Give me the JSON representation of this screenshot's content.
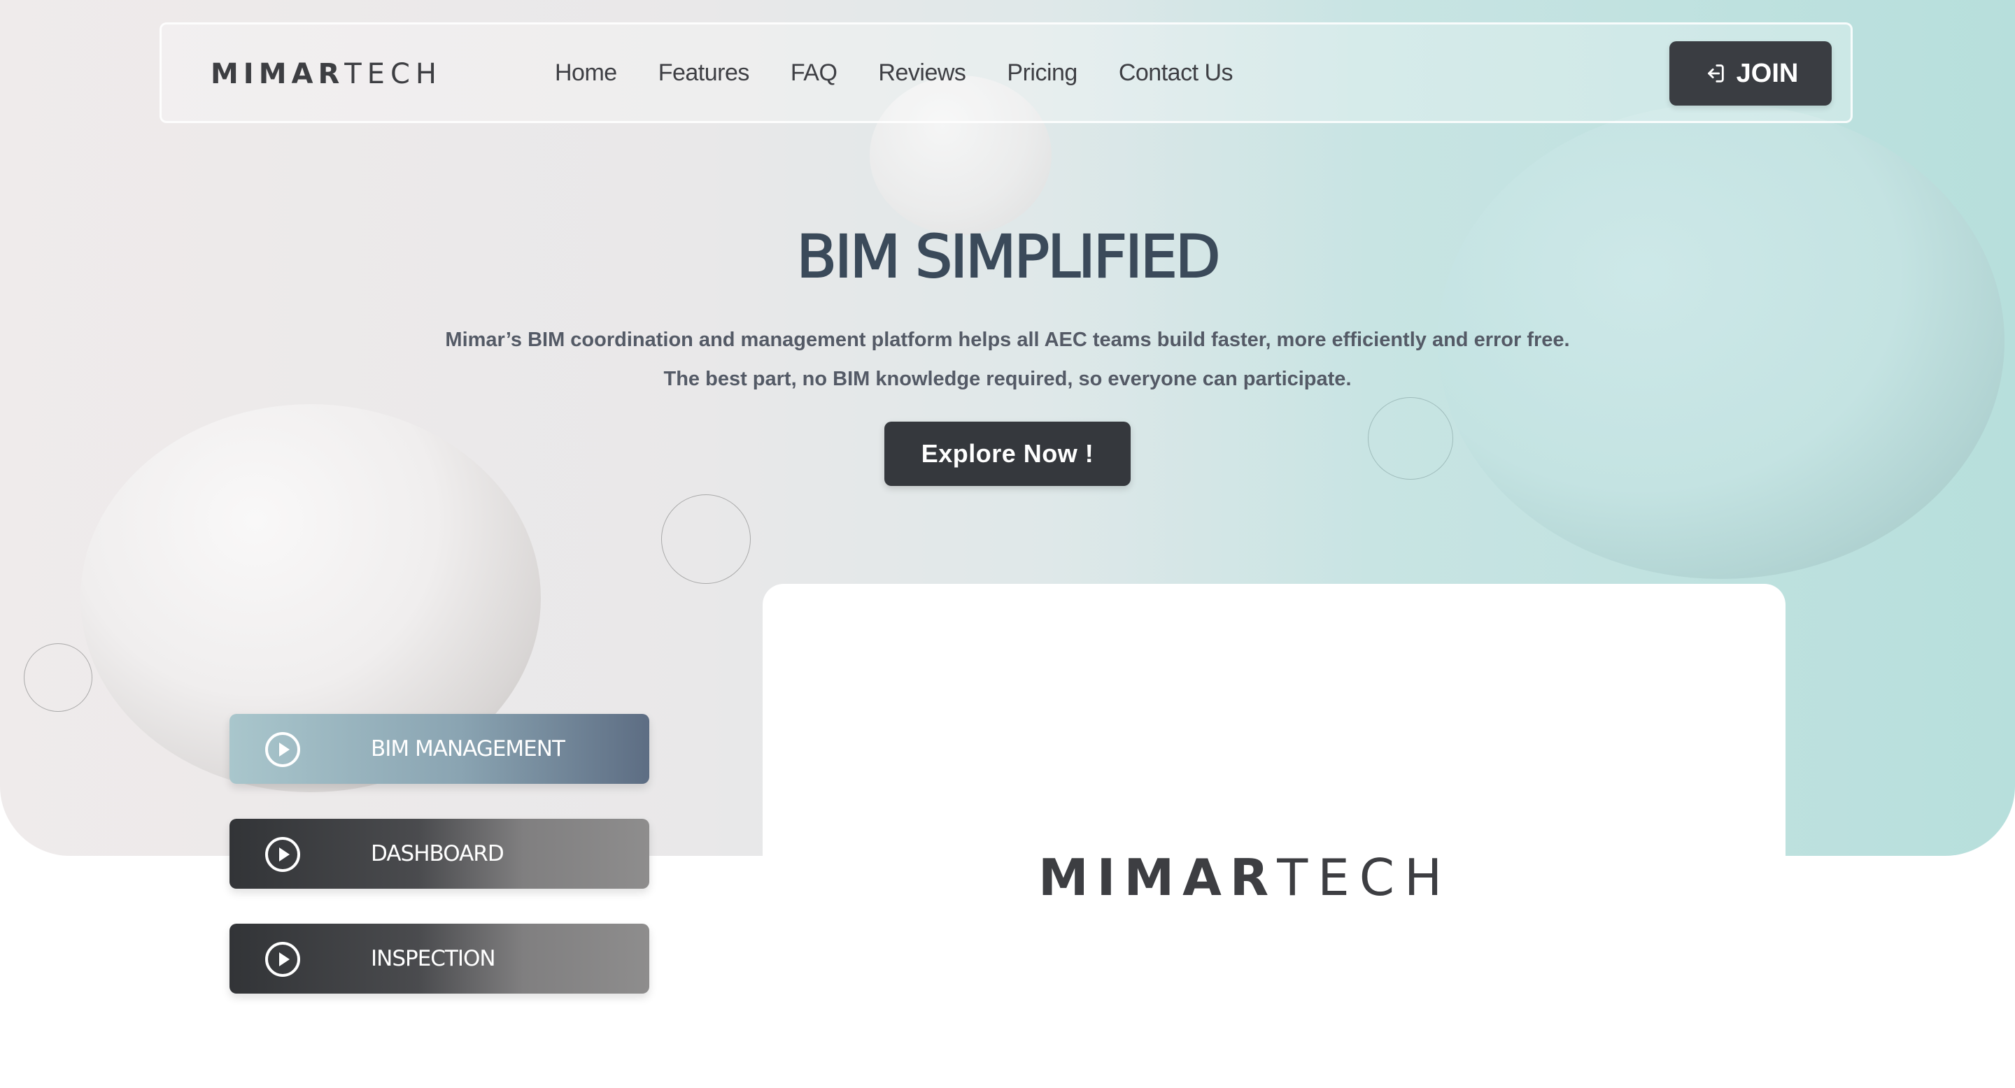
{
  "brand": {
    "logo_strong": "MIMAR",
    "logo_light": "TECH"
  },
  "nav": {
    "links": [
      {
        "label": "Home"
      },
      {
        "label": "Features"
      },
      {
        "label": "FAQ"
      },
      {
        "label": "Reviews"
      },
      {
        "label": "Pricing"
      },
      {
        "label": "Contact Us"
      }
    ],
    "join_label": "JOIN",
    "join_icon": "sign-in-icon"
  },
  "hero": {
    "title": "BIM SIMPLIFIED",
    "subtitle_line1": "Mimar’s BIM coordination and management platform helps all AEC teams build faster, more efficiently and error free.",
    "subtitle_line2": "The best part, no BIM knowledge required, so everyone can participate.",
    "cta_label": "Explore Now !"
  },
  "features": [
    {
      "label": "BIM MANAGEMENT",
      "icon": "play-circle-icon",
      "active": true
    },
    {
      "label": "DASHBOARD",
      "icon": "play-circle-icon",
      "active": false
    },
    {
      "label": "INSPECTION",
      "icon": "play-circle-icon",
      "active": false
    }
  ],
  "colors": {
    "dark_button": "#35383d",
    "accent_teal": "#b7dfdc",
    "text_dark": "#3b4a5a",
    "active_gradient_start": "#a9c6cc",
    "active_gradient_end": "#5d6d83"
  }
}
